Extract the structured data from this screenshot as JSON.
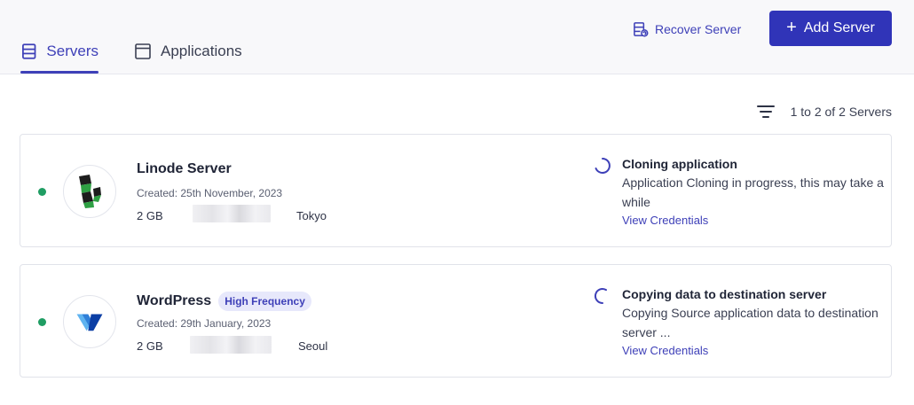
{
  "tabs": [
    {
      "label": "Servers",
      "active": true
    },
    {
      "label": "Applications",
      "active": false
    }
  ],
  "actions": {
    "recover_label": "Recover Server",
    "add_label": "Add Server",
    "add_icon": "plus-icon"
  },
  "pagination": {
    "summary": "1 to 2 of 2 Servers",
    "filter_icon": "filter-icon"
  },
  "colors": {
    "accent": "#3e40b8",
    "primary_button": "#3034b8",
    "online": "#1f9d63",
    "badge_bg": "#e7e8fb"
  },
  "servers": [
    {
      "name": "Linode Server",
      "badge": "",
      "created": "Created: 25th November, 2023",
      "size": "2 GB",
      "location": "Tokyo",
      "status": "online",
      "logo_icon": "linode-logo-icon",
      "task_title": "Cloning application",
      "task_desc": "Application Cloning in progress, this may take a while",
      "task_link": "View Credentials"
    },
    {
      "name": "WordPress",
      "badge": "High Frequency",
      "created": "Created: 29th January, 2023",
      "size": "2 GB",
      "location": "Seoul",
      "status": "online",
      "logo_icon": "vultr-logo-icon",
      "task_title": "Copying data to destination server",
      "task_desc": "Copying Source application data to destination server ...",
      "task_link": "View Credentials"
    }
  ]
}
